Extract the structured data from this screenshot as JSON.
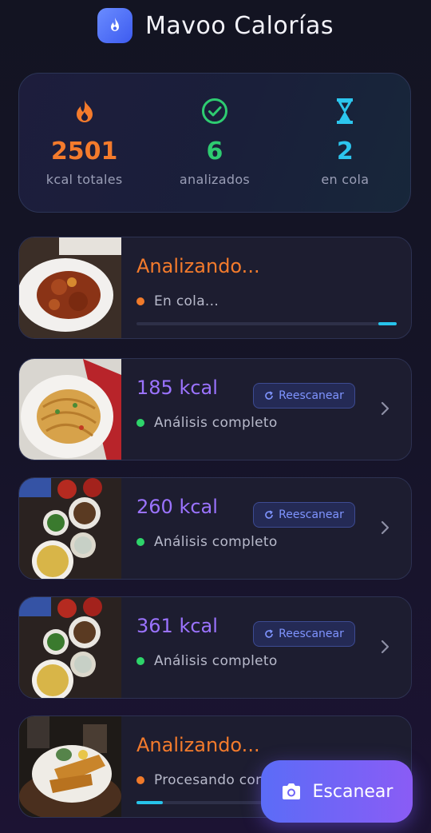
{
  "app": {
    "title": "Mavoo Calorías"
  },
  "stats": [
    {
      "icon": "flame-icon",
      "value": "2501",
      "label": "kcal totales",
      "color": "#f47b2c"
    },
    {
      "icon": "check-circle-icon",
      "value": "6",
      "label": "analizados",
      "color": "#2ecc71"
    },
    {
      "icon": "hourglass-icon",
      "value": "2",
      "label": "en cola",
      "color": "#2cc6ee"
    }
  ],
  "cards": [
    {
      "title": "Analizando...",
      "status": "En cola...",
      "state": "pending",
      "progress": 0.07
    },
    {
      "title": "185 kcal",
      "status": "Análisis completo",
      "state": "done",
      "rescan": "Reescanear"
    },
    {
      "title": "260 kcal",
      "status": "Análisis completo",
      "state": "done",
      "rescan": "Reescanear"
    },
    {
      "title": "361 kcal",
      "status": "Análisis completo",
      "state": "done",
      "rescan": "Reescanear"
    },
    {
      "title": "Analizando...",
      "status": "Procesando con IA...",
      "state": "processing",
      "progress": 0.1
    }
  ],
  "fab": {
    "label": "Escanear",
    "icon": "camera-icon"
  },
  "colors": {
    "accent": "#8a5cf5",
    "orange": "#f47b2c",
    "green": "#2ed46a",
    "cyan": "#27c3ea",
    "purple": "#9b73ff"
  }
}
